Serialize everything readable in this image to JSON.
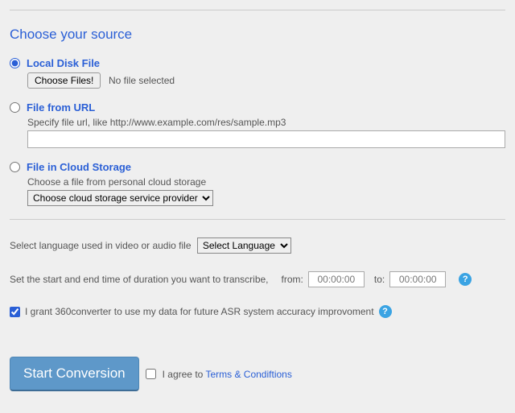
{
  "sectionTitle": "Choose your source",
  "source": {
    "local": {
      "label": "Local Disk File",
      "button": "Choose Files!",
      "status": "No file selected"
    },
    "url": {
      "label": "File from URL",
      "hint": "Specify file url, like http://www.example.com/res/sample.mp3",
      "value": ""
    },
    "cloud": {
      "label": "File in Cloud Storage",
      "hint": "Choose a file from personal cloud storage",
      "selectDefault": "Choose cloud storage service provider"
    }
  },
  "language": {
    "prompt": "Select language used in video or audio file",
    "selectDefault": "Select Language"
  },
  "duration": {
    "prompt": "Set the start and end time of duration you want to transcribe,",
    "fromLabel": "from:",
    "fromValue": "00:00:00",
    "toLabel": "to:",
    "toValue": "00:00:00"
  },
  "grant": {
    "text": "I grant 360converter to use my data for future ASR system accuracy improvoment"
  },
  "action": {
    "start": "Start Conversion",
    "agreePrefix": "I agree to ",
    "termsLink": "Terms & Condiftions"
  },
  "helpGlyph": "?"
}
